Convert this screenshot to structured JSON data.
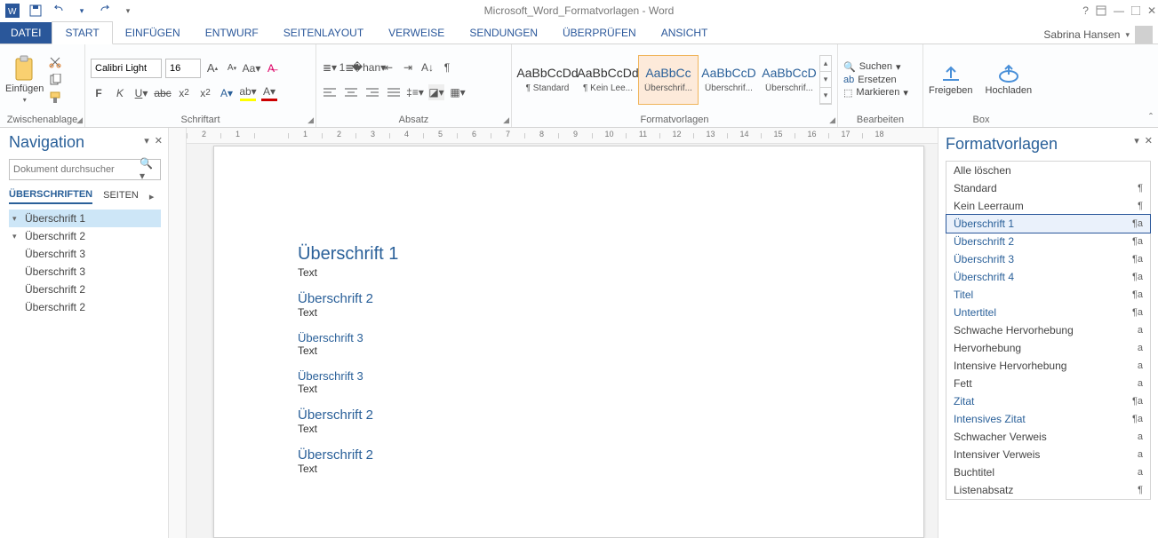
{
  "title": "Microsoft_Word_Formatvorlagen - Word",
  "user": "Sabrina Hansen",
  "tabs": [
    "DATEI",
    "START",
    "EINFÜGEN",
    "ENTWURF",
    "SEITENLAYOUT",
    "VERWEISE",
    "SENDUNGEN",
    "ÜBERPRÜFEN",
    "ANSICHT"
  ],
  "clipboard": {
    "label": "Einfügen",
    "group": "Zwischenablage"
  },
  "font": {
    "name": "Calibri Light",
    "size": "16",
    "group": "Schriftart"
  },
  "para": {
    "group": "Absatz"
  },
  "stylesGallery": {
    "group": "Formatvorlagen",
    "items": [
      {
        "preview": "AaBbCcDd",
        "name": "¶ Standard"
      },
      {
        "preview": "AaBbCcDd",
        "name": "¶ Kein Lee..."
      },
      {
        "preview": "AaBbCc",
        "name": "Überschrif...",
        "blue": true,
        "sel": true
      },
      {
        "preview": "AaBbCcD",
        "name": "Überschrif...",
        "blue": true
      },
      {
        "preview": "AaBbCcD",
        "name": "Überschrif...",
        "blue": true
      }
    ]
  },
  "edit": {
    "find": "Suchen",
    "replace": "Ersetzen",
    "select": "Markieren",
    "group": "Bearbeiten"
  },
  "box": {
    "share": "Freigeben",
    "upload": "Hochladen",
    "group": "Box"
  },
  "nav": {
    "title": "Navigation",
    "search": "Dokument durchsucher",
    "tabs": [
      "ÜBERSCHRIFTEN",
      "SEITEN"
    ],
    "tree": [
      {
        "lvl": 1,
        "label": "Überschrift 1",
        "caret": "▾",
        "sel": true
      },
      {
        "lvl": 2,
        "label": "Überschrift 2",
        "caret": "▾"
      },
      {
        "lvl": 3,
        "label": "Überschrift 3"
      },
      {
        "lvl": 3,
        "label": "Überschrift 3"
      },
      {
        "lvl": 2,
        "label": "Überschrift 2"
      },
      {
        "lvl": 2,
        "label": "Überschrift 2"
      }
    ]
  },
  "doc": [
    {
      "tag": "h1",
      "text": "Überschrift 1"
    },
    {
      "tag": "p",
      "text": "Text"
    },
    {
      "tag": "h2",
      "text": "Überschrift 2"
    },
    {
      "tag": "p",
      "text": "Text"
    },
    {
      "tag": "h3",
      "text": "Überschrift 3"
    },
    {
      "tag": "p",
      "text": "Text"
    },
    {
      "tag": "h3",
      "text": "Überschrift 3"
    },
    {
      "tag": "p",
      "text": "Text"
    },
    {
      "tag": "h2",
      "text": "Überschrift 2"
    },
    {
      "tag": "p",
      "text": "Text"
    },
    {
      "tag": "h2",
      "text": "Überschrift 2"
    },
    {
      "tag": "p",
      "text": "Text"
    }
  ],
  "ruler": [
    "2",
    "1",
    "",
    "1",
    "2",
    "3",
    "4",
    "5",
    "6",
    "7",
    "8",
    "9",
    "10",
    "11",
    "12",
    "13",
    "14",
    "15",
    "16",
    "17",
    "18"
  ],
  "styles": {
    "title": "Formatvorlagen",
    "items": [
      {
        "name": "Alle löschen",
        "mk": ""
      },
      {
        "name": "Standard",
        "mk": "¶"
      },
      {
        "name": "Kein Leerraum",
        "mk": "¶"
      },
      {
        "name": "Überschrift 1",
        "mk": "¶a",
        "h": true,
        "sel": true
      },
      {
        "name": "Überschrift 2",
        "mk": "¶a",
        "h": true
      },
      {
        "name": "Überschrift 3",
        "mk": "¶a",
        "h": true
      },
      {
        "name": "Überschrift 4",
        "mk": "¶a",
        "h": true
      },
      {
        "name": "Titel",
        "mk": "¶a",
        "h": true
      },
      {
        "name": "Untertitel",
        "mk": "¶a",
        "h": true
      },
      {
        "name": "Schwache Hervorhebung",
        "mk": "a"
      },
      {
        "name": "Hervorhebung",
        "mk": "a"
      },
      {
        "name": "Intensive Hervorhebung",
        "mk": "a"
      },
      {
        "name": "Fett",
        "mk": "a"
      },
      {
        "name": "Zitat",
        "mk": "¶a",
        "h": true
      },
      {
        "name": "Intensives Zitat",
        "mk": "¶a",
        "h": true
      },
      {
        "name": "Schwacher Verweis",
        "mk": "a"
      },
      {
        "name": "Intensiver Verweis",
        "mk": "a"
      },
      {
        "name": "Buchtitel",
        "mk": "a"
      },
      {
        "name": "Listenabsatz",
        "mk": "¶"
      }
    ]
  }
}
